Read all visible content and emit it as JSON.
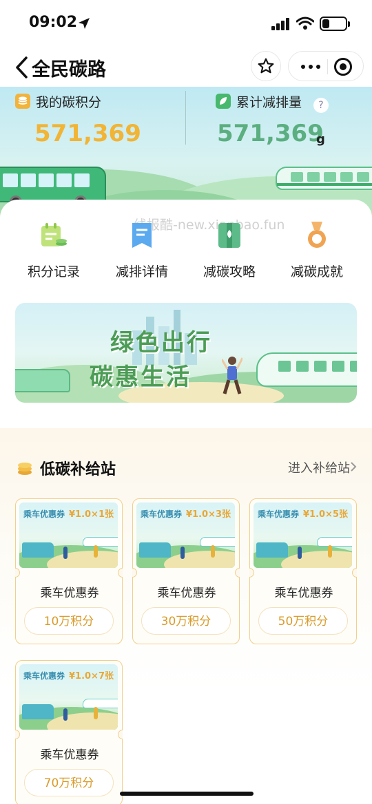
{
  "status_bar": {
    "time": "09:02",
    "battery_level": 0.3
  },
  "nav": {
    "title": "全民碳路"
  },
  "hero": {
    "points_label": "我的碳积分",
    "points_value": "571,369",
    "reduction_label": "累计减排量",
    "reduction_value": "571,369",
    "reduction_unit": "g",
    "help_glyph": "?"
  },
  "watermark": "线报酷-new.xianbao.fun",
  "features": [
    {
      "label": "积分记录",
      "icon": "points-record-icon"
    },
    {
      "label": "减排详情",
      "icon": "reduction-detail-icon"
    },
    {
      "label": "减碳攻略",
      "icon": "strategy-icon"
    },
    {
      "label": "减碳成就",
      "icon": "medal-icon"
    }
  ],
  "banner": {
    "line1": "绿色出行",
    "line2": "碳惠生活"
  },
  "section": {
    "title": "低碳补给站",
    "enter_label": "进入补给站"
  },
  "coupons": [
    {
      "tag": "乘车优惠券",
      "value": "¥1.0×1张",
      "name": "乘车优惠券",
      "price": "10万积分"
    },
    {
      "tag": "乘车优惠券",
      "value": "¥1.0×3张",
      "name": "乘车优惠券",
      "price": "30万积分"
    },
    {
      "tag": "乘车优惠券",
      "value": "¥1.0×5张",
      "name": "乘车优惠券",
      "price": "50万积分"
    },
    {
      "tag": "乘车优惠券",
      "value": "¥1.0×7张",
      "name": "乘车优惠券",
      "price": "70万积分"
    }
  ],
  "colors": {
    "points": "#f1b435",
    "reduction": "#5bae7f",
    "price": "#d99b2a",
    "coupon_border": "#f1cf8c"
  }
}
